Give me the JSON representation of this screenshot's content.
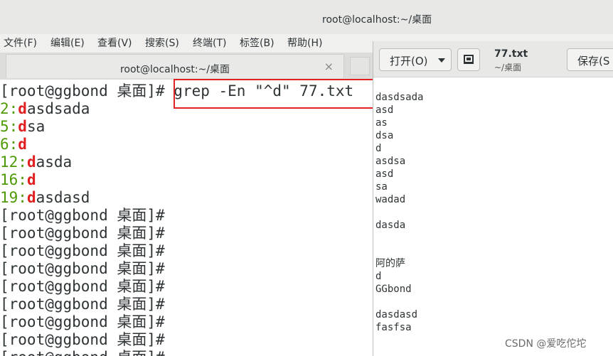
{
  "terminal": {
    "title": "root@localhost:~/桌面",
    "menu": [
      "文件(F)",
      "编辑(E)",
      "查看(V)",
      "搜索(S)",
      "终端(T)",
      "标签(B)",
      "帮助(H)"
    ],
    "tab_title": "root@localhost:~/桌面",
    "tab_close": "×",
    "lines": [
      {
        "type": "command",
        "prompt": "[root@ggbond 桌面]#",
        "command": " grep -En \"^d\" 77.txt"
      },
      {
        "type": "match",
        "num": "2:",
        "hit": "d",
        "rest": "asdsada"
      },
      {
        "type": "match",
        "num": "5:",
        "hit": "d",
        "rest": "sa"
      },
      {
        "type": "match",
        "num": "6:",
        "hit": "d",
        "rest": ""
      },
      {
        "type": "match",
        "num": "12:",
        "hit": "d",
        "rest": "asda"
      },
      {
        "type": "match",
        "num": "16:",
        "hit": "d",
        "rest": ""
      },
      {
        "type": "match",
        "num": "19:",
        "hit": "d",
        "rest": "asdasd"
      },
      {
        "type": "prompt",
        "prompt": "[root@ggbond 桌面]#"
      },
      {
        "type": "prompt",
        "prompt": "[root@ggbond 桌面]#"
      },
      {
        "type": "prompt",
        "prompt": "[root@ggbond 桌面]#"
      },
      {
        "type": "prompt",
        "prompt": "[root@ggbond 桌面]#"
      },
      {
        "type": "prompt",
        "prompt": "[root@ggbond 桌面]#"
      },
      {
        "type": "prompt",
        "prompt": "[root@ggbond 桌面]#"
      },
      {
        "type": "prompt",
        "prompt": "[root@ggbond 桌面]#"
      },
      {
        "type": "prompt",
        "prompt": "[root@ggbond 桌面]#"
      },
      {
        "type": "prompt",
        "prompt": "[root@ggbond 桌面]#"
      }
    ]
  },
  "gedit": {
    "open_label": "打开(O)",
    "save_label": "保存(S",
    "file_name": "77.txt",
    "file_path": "~/桌面",
    "lines": [
      "dasdsada",
      "asd",
      "as",
      "dsa",
      "d",
      "asdsa",
      "asd",
      "sa",
      "wadad",
      "",
      "dasda",
      "",
      "",
      "阿的萨",
      "d",
      "GGbond",
      "",
      "dasdasd",
      "fasfsa"
    ]
  },
  "watermark": "CSDN @爱吃佗坨",
  "colors": {
    "line_number": "#4e9a06",
    "match": "#e02020",
    "highlight_border": "#e02424"
  }
}
